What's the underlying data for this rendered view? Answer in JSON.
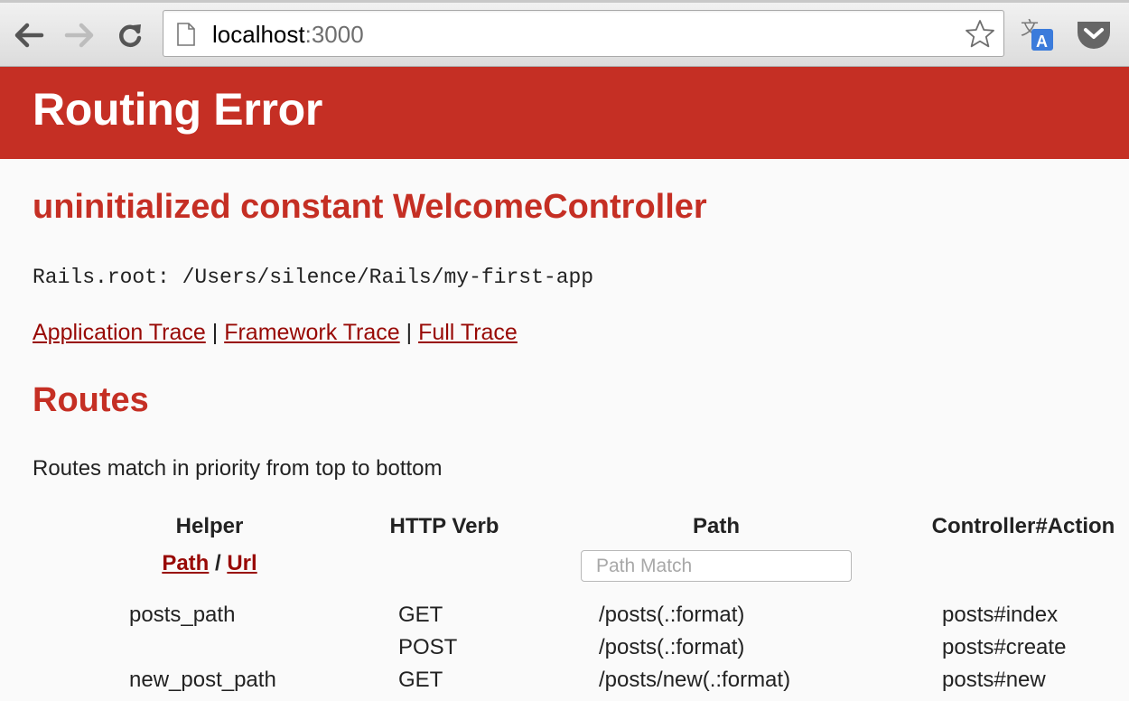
{
  "browser": {
    "url_host": "localhost",
    "url_port": ":3000",
    "icons": {
      "back": "back-arrow-icon",
      "forward": "forward-arrow-icon",
      "reload": "reload-icon",
      "page": "page-icon",
      "bookmark": "star-icon",
      "translate": "translate-icon",
      "pocket": "pocket-icon"
    }
  },
  "header": {
    "title": "Routing Error"
  },
  "error": {
    "message": "uninitialized constant WelcomeController",
    "rails_root": "Rails.root: /Users/silence/Rails/my-first-app"
  },
  "traces": {
    "application": "Application Trace",
    "framework": "Framework Trace",
    "full": "Full Trace",
    "separator": "|"
  },
  "routes": {
    "title": "Routes",
    "description": "Routes match in priority from top to bottom",
    "headers": {
      "helper": "Helper",
      "verb": "HTTP Verb",
      "path": "Path",
      "controller": "Controller#Action"
    },
    "helper_links": {
      "path": "Path",
      "separator": "/",
      "url": "Url"
    },
    "path_match_placeholder": "Path Match",
    "rows": [
      {
        "helper": "posts_path",
        "verb": "GET",
        "path": "/posts(.:format)",
        "action": "posts#index"
      },
      {
        "helper": "",
        "verb": "POST",
        "path": "/posts(.:format)",
        "action": "posts#create"
      },
      {
        "helper": "new_post_path",
        "verb": "GET",
        "path": "/posts/new(.:format)",
        "action": "posts#new"
      }
    ]
  },
  "colors": {
    "header_bg": "#c52f24",
    "heading_text": "#c52f24",
    "link": "#980905",
    "page_bg": "#fafafa"
  }
}
